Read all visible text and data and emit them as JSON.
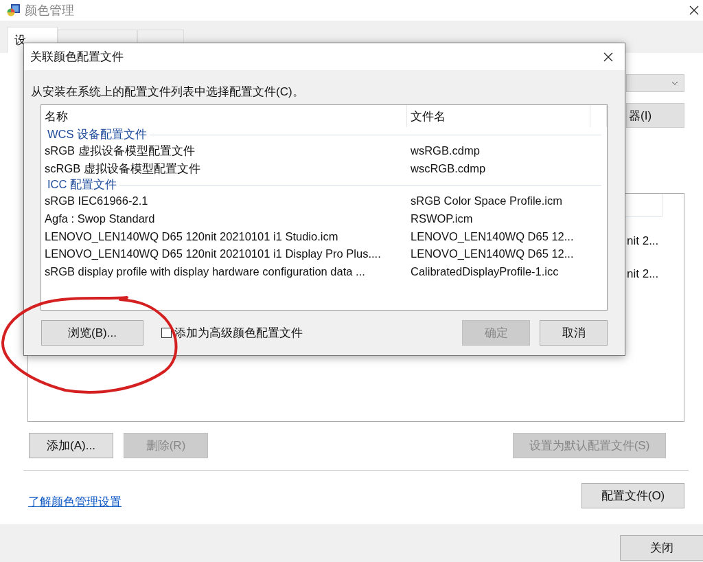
{
  "window": {
    "title": "颜色管理"
  },
  "tabs": [
    {
      "label": "设",
      "selected": true
    },
    {
      "selected": false
    },
    {
      "selected": false
    }
  ],
  "device_panel": {
    "partial_button": "器(I)",
    "profile_list": {
      "rows": [
        "nit 2...",
        "nit 2..."
      ]
    },
    "buttons": [
      {
        "label": "添加(A)...",
        "disabled": false
      },
      {
        "label": "删除(R)",
        "disabled": true
      },
      {
        "label": "设置为默认配置文件(S)",
        "disabled": true
      }
    ]
  },
  "link": "了解颜色管理设置",
  "profiles_button": "配置文件(O)",
  "close_button": "关闭",
  "dialog": {
    "title": "关联颜色配置文件",
    "instruction": "从安装在系统上的配置文件列表中选择配置文件(C)。",
    "columns": [
      "名称",
      "文件名"
    ],
    "groups": [
      {
        "label": "WCS 设备配置文件",
        "rows": [
          {
            "name": "sRGB 虚拟设备模型配置文件",
            "file": "wsRGB.cdmp"
          },
          {
            "name": "scRGB 虚拟设备模型配置文件",
            "file": "wscRGB.cdmp"
          }
        ]
      },
      {
        "label": "ICC 配置文件",
        "rows": [
          {
            "name": "sRGB IEC61966-2.1",
            "file": "sRGB Color Space Profile.icm"
          },
          {
            "name": "Agfa : Swop Standard",
            "file": "RSWOP.icm"
          },
          {
            "name": "LENOVO_LEN140WQ D65 120nit 20210101 i1 Studio.icm",
            "file": "LENOVO_LEN140WQ D65 12..."
          },
          {
            "name": "LENOVO_LEN140WQ D65 120nit 20210101 i1 Display Pro Plus....",
            "file": "LENOVO_LEN140WQ D65 12..."
          },
          {
            "name": "sRGB display profile with display hardware configuration data ...",
            "file": "CalibratedDisplayProfile-1.icc"
          }
        ]
      }
    ],
    "browse_button": "浏览(B)...",
    "checkbox": {
      "label": "添加为高级颜色配置文件",
      "checked": false
    },
    "buttons": [
      {
        "label": "确定",
        "disabled": true
      },
      {
        "label": "取消",
        "disabled": false
      }
    ]
  }
}
